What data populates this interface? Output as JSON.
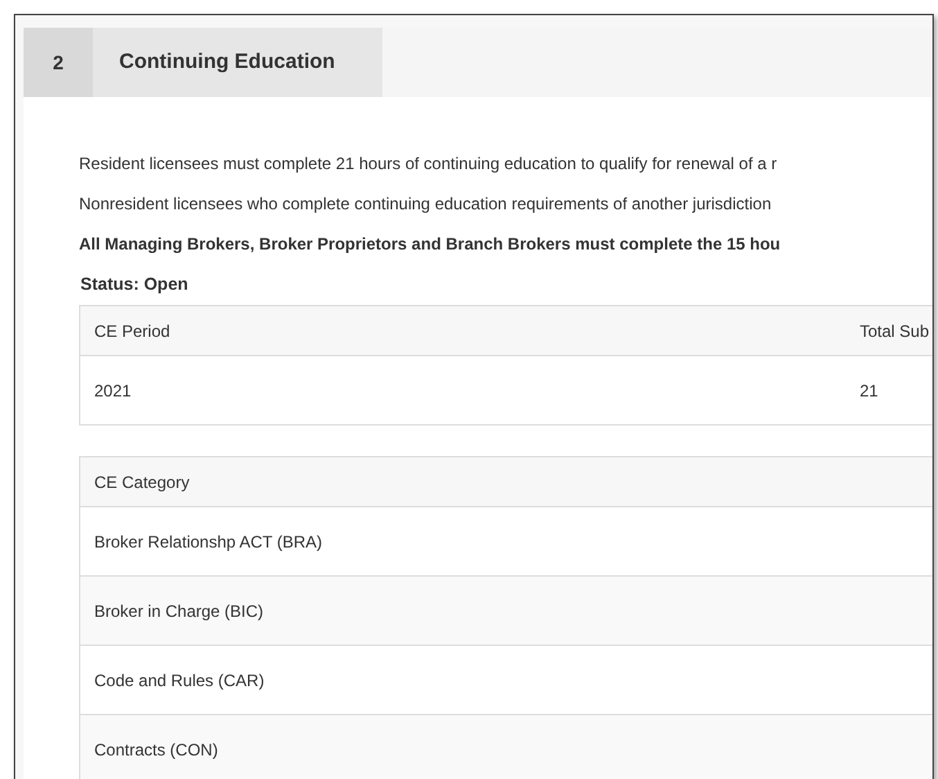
{
  "section": {
    "number": "2",
    "title": "Continuing Education"
  },
  "paragraphs": [
    {
      "text": "Resident licensees must complete 21 hours of continuing education to qualify for renewal of a r",
      "bold": false
    },
    {
      "text": "Nonresident licensees who complete continuing education requirements of another jurisdiction",
      "bold": false
    },
    {
      "text": "All Managing Brokers, Broker Proprietors and Branch Brokers must complete the 15 hou",
      "bold": true
    }
  ],
  "status": "Status: Open",
  "period_table": {
    "columns": [
      "CE Period",
      "Total Sub"
    ],
    "rows": [
      [
        "2021",
        "21"
      ]
    ]
  },
  "category_table": {
    "columns": [
      "CE Category"
    ],
    "rows": [
      [
        "Broker Relationshp ACT (BRA)"
      ],
      [
        "Broker in Charge (BIC)"
      ],
      [
        "Code and Rules (CAR)"
      ],
      [
        "Contracts (CON)"
      ]
    ]
  }
}
